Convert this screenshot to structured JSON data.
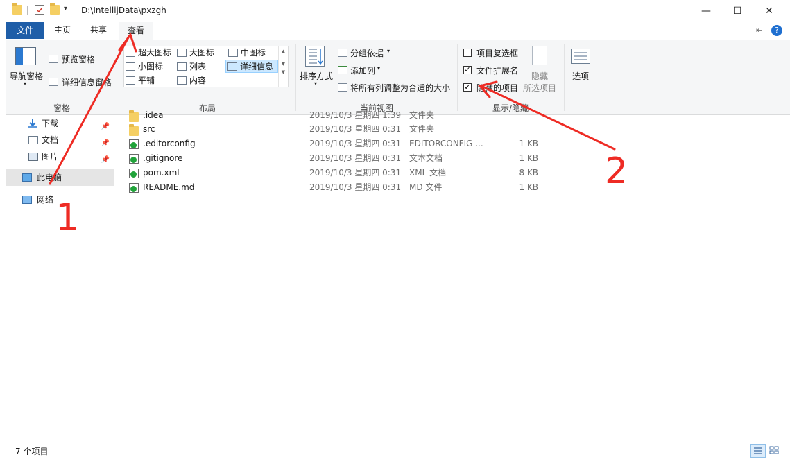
{
  "window": {
    "path": "D:\\IntellijData\\pxzgh",
    "minimize": "—",
    "maximize": "☐",
    "close": "✕"
  },
  "tabs": {
    "file": "文件",
    "home": "主页",
    "share": "共享",
    "view": "查看"
  },
  "ribbon": {
    "panes": {
      "nav_pane": "导航窗格",
      "preview_pane": "预览窗格",
      "details_pane": "详细信息窗格",
      "label": "窗格"
    },
    "layout": {
      "extra_large": "超大图标",
      "large": "大图标",
      "medium": "中图标",
      "small": "小图标",
      "list": "列表",
      "details": "详细信息",
      "tiles": "平铺",
      "content": "内容",
      "label": "布局"
    },
    "current_view": {
      "sort_by": "排序方式",
      "group_by": "分组依据",
      "add_column": "添加列",
      "fit_columns": "将所有列调整为合适的大小",
      "label": "当前视图"
    },
    "show_hide": {
      "item_checkboxes": "项目复选框",
      "item_checkboxes_checked": false,
      "extensions": "文件扩展名",
      "extensions_checked": true,
      "hidden_items": "隐藏的项目",
      "hidden_items_checked": true,
      "hide_selected_1": "隐藏",
      "hide_selected_2": "所选项目",
      "label": "显示/隐藏"
    },
    "options": "选项"
  },
  "nav": {
    "items": [
      {
        "label": "下载",
        "pinned": true
      },
      {
        "label": "文档",
        "pinned": true
      },
      {
        "label": "图片",
        "pinned": true
      },
      {
        "label": "此电脑",
        "pinned": false
      },
      {
        "label": "网络",
        "pinned": false
      }
    ]
  },
  "files": [
    {
      "name": ".idea",
      "date": "2019/10/3 星期四 1:39",
      "type": "文件夹",
      "size": ""
    },
    {
      "name": "src",
      "date": "2019/10/3 星期四 0:31",
      "type": "文件夹",
      "size": ""
    },
    {
      "name": ".editorconfig",
      "date": "2019/10/3 星期四 0:31",
      "type": "EDITORCONFIG ...",
      "size": "1 KB"
    },
    {
      "name": ".gitignore",
      "date": "2019/10/3 星期四 0:31",
      "type": "文本文档",
      "size": "1 KB"
    },
    {
      "name": "pom.xml",
      "date": "2019/10/3 星期四 0:31",
      "type": "XML 文档",
      "size": "8 KB"
    },
    {
      "name": "README.md",
      "date": "2019/10/3 星期四 0:31",
      "type": "MD 文件",
      "size": "1 KB"
    }
  ],
  "status": {
    "count": "7 个项目"
  },
  "annotations": {
    "label_1": "1",
    "label_2": "2",
    "color": "#ee2b24"
  }
}
